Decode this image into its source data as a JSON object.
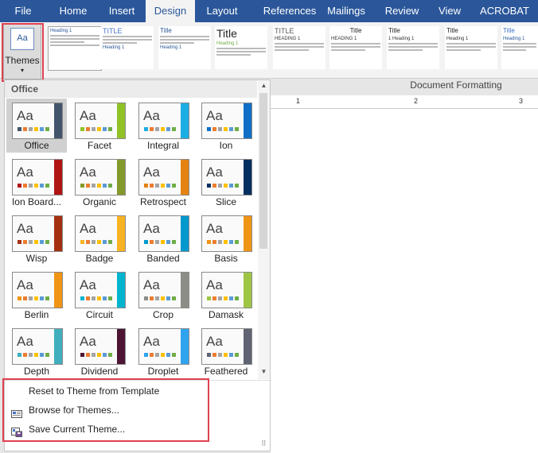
{
  "tabs": [
    {
      "label": "File",
      "active": false
    },
    {
      "label": "Home",
      "active": false
    },
    {
      "label": "Insert",
      "active": false
    },
    {
      "label": "Design",
      "active": true
    },
    {
      "label": "Layout",
      "active": false
    },
    {
      "label": "References",
      "active": false
    },
    {
      "label": "Mailings",
      "active": false
    },
    {
      "label": "Review",
      "active": false
    },
    {
      "label": "View",
      "active": false
    },
    {
      "label": "ACROBAT",
      "active": false
    }
  ],
  "themes_button": {
    "icon_text": "Aa",
    "label": "Themes",
    "arrow": "▾"
  },
  "style_sets": [
    {
      "title": "",
      "heading": "Heading 1"
    },
    {
      "title": "TITLE",
      "heading": "Heading 1"
    },
    {
      "title": "Title",
      "heading": "Heading 1"
    },
    {
      "title": "Title",
      "heading": "Heading 1"
    },
    {
      "title": "TITLE",
      "heading": "HEADING 1"
    },
    {
      "title": "Title",
      "heading": "HEADING 1"
    },
    {
      "title": "Title",
      "heading": "1 Heading 1"
    },
    {
      "title": "Title",
      "heading": "Heading 1"
    },
    {
      "title": "Title",
      "heading": "Heading 1"
    }
  ],
  "ribbon_group_label": "Document Formatting",
  "ruler_ticks": [
    "1",
    "2",
    "3"
  ],
  "panel": {
    "section_label": "Office",
    "themes": [
      {
        "name": "Office",
        "accent": "#44546a",
        "selected": true
      },
      {
        "name": "Facet",
        "accent": "#90c226",
        "selected": false
      },
      {
        "name": "Integral",
        "accent": "#1cade4",
        "selected": false
      },
      {
        "name": "Ion",
        "accent": "#0f6fc6",
        "selected": false
      },
      {
        "name": "Ion Board...",
        "accent": "#b01513",
        "selected": false
      },
      {
        "name": "Organic",
        "accent": "#83992a",
        "selected": false
      },
      {
        "name": "Retrospect",
        "accent": "#e48312",
        "selected": false
      },
      {
        "name": "Slice",
        "accent": "#052f61",
        "selected": false
      },
      {
        "name": "Wisp",
        "accent": "#a53010",
        "selected": false
      },
      {
        "name": "Badge",
        "accent": "#f8b323",
        "selected": false
      },
      {
        "name": "Banded",
        "accent": "#0098cd",
        "selected": false
      },
      {
        "name": "Basis",
        "accent": "#f09415",
        "selected": false
      },
      {
        "name": "Berlin",
        "accent": "#f09415",
        "selected": false
      },
      {
        "name": "Circuit",
        "accent": "#03b4cf",
        "selected": false
      },
      {
        "name": "Crop",
        "accent": "#8c8d86",
        "selected": false
      },
      {
        "name": "Damask",
        "accent": "#9ec544",
        "selected": false
      },
      {
        "name": "Depth",
        "accent": "#41aebd",
        "selected": false
      },
      {
        "name": "Dividend",
        "accent": "#4d1434",
        "selected": false
      },
      {
        "name": "Droplet",
        "accent": "#2fa3ee",
        "selected": false
      },
      {
        "name": "Feathered",
        "accent": "#606372",
        "selected": false
      }
    ],
    "swatch_colors": [
      "#4472c4",
      "#ed7d31",
      "#a5a5a5",
      "#ffc000",
      "#5b9bd5",
      "#70ad47"
    ],
    "commands": [
      {
        "label": "Reset to Theme from Template",
        "icon": "none"
      },
      {
        "label": "Browse for Themes...",
        "icon": "folder-browse-icon"
      },
      {
        "label": "Save Current Theme...",
        "icon": "save-theme-icon"
      }
    ],
    "scroll_up": "▲",
    "scroll_down": "▼",
    "grip": "⠿"
  },
  "colors": {
    "ribbon_blue": "#2b579a",
    "highlight_red": "#e04050"
  }
}
